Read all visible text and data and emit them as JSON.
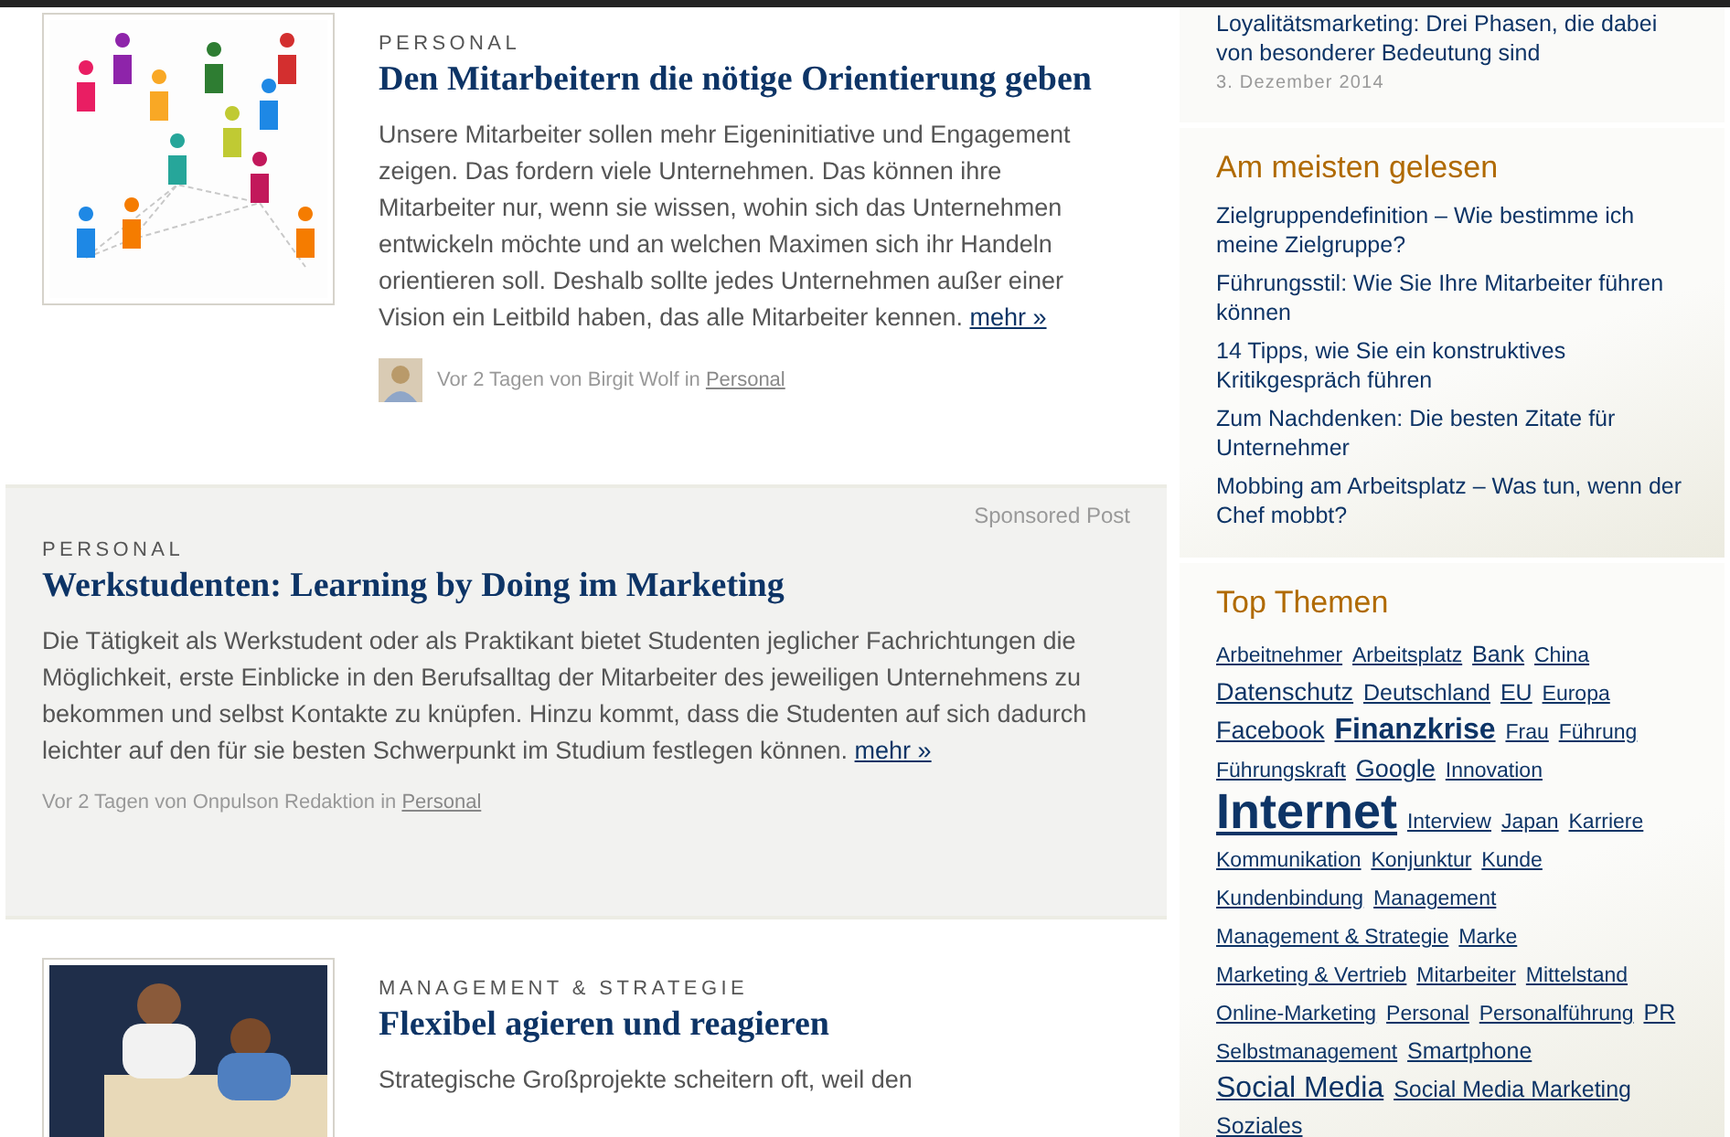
{
  "articles": [
    {
      "kind": "standard",
      "category": "PERSONAL",
      "title": "Den Mitarbeitern die nötige Orientierung geben",
      "body": "Unsere Mitarbeiter sollen mehr Eigeninitiative und Engagement zeigen. Das fordern viele Unternehmen. Das können ihre Mitarbeiter nur, wenn sie wissen, wohin sich das Unternehmen entwickeln möchte und an welchen Maximen sich ihr Handeln orientieren soll. Deshalb sollte jedes Unternehmen außer einer Vision ein Leitbild haben, das alle Mitarbeiter kennen.",
      "more": "mehr »",
      "meta": "Vor 2 Tagen von Birgit Wolf in ",
      "meta_link": "Personal",
      "avatar": true
    },
    {
      "kind": "sponsored",
      "label": "Sponsored Post",
      "category": "PERSONAL",
      "title": "Werkstudenten: Learning by Doing im Marketing",
      "body": "Die Tätigkeit als Werkstudent oder als Praktikant bietet Studenten jeglicher Fachrichtungen die Möglichkeit, erste Einblicke in den Berufsalltag der Mitarbeiter des jeweiligen Unternehmens zu bekommen und selbst Kontakte zu knüpfen. Hinzu kommt, dass die Studenten auf sich dadurch leichter auf den für sie besten Schwerpunkt im Studium festlegen können.",
      "more": "mehr »",
      "meta": "Vor 2 Tagen von Onpulson Redaktion in ",
      "meta_link": "Personal",
      "avatar": false
    },
    {
      "kind": "standard",
      "category": "MANAGEMENT & STRATEGIE",
      "title": "Flexibel agieren und reagieren",
      "body": "Strategische Großprojekte scheitern oft, weil den"
    }
  ],
  "latest": {
    "link": "Loyalitätsmarketing: Drei Phasen, die dabei von besonderer Bedeutung sind",
    "date": "3. Dezember 2014"
  },
  "most_read": {
    "title": "Am meisten gelesen",
    "items": [
      "Zielgruppendefinition – Wie bestimme ich meine Zielgruppe?",
      "Führungsstil: Wie Sie Ihre Mitarbeiter führen können",
      "14 Tipps, wie Sie ein konstruktives Kritikgespräch führen",
      "Zum Nachdenken: Die besten Zitate für Unternehmer",
      "Mobbing am Arbeitsplatz – Was tun, wenn der Chef mobbt?"
    ]
  },
  "top_topics": {
    "title": "Top Themen",
    "tags": [
      {
        "label": "Arbeitnehmer",
        "kind": "small"
      },
      {
        "label": "Arbeitsplatz",
        "kind": "small"
      },
      {
        "label": "Bank",
        "kind": "medium"
      },
      {
        "label": "China",
        "kind": "small"
      },
      {
        "label": "Datenschutz",
        "kind": "large"
      },
      {
        "label": "Deutschland",
        "kind": "medium"
      },
      {
        "label": "EU",
        "kind": "medium"
      },
      {
        "label": "Europa",
        "kind": "small"
      },
      {
        "label": "Facebook",
        "kind": "large"
      },
      {
        "label": "Finanzkrise",
        "kind": "strong"
      },
      {
        "label": "Frau",
        "kind": "small"
      },
      {
        "label": "Führung",
        "kind": "small"
      },
      {
        "label": "Führungskraft",
        "kind": "small"
      },
      {
        "label": "Google",
        "kind": "large"
      },
      {
        "label": "Innovation",
        "kind": "small"
      },
      {
        "label": "Internet",
        "kind": "huge"
      },
      {
        "label": "Interview",
        "kind": "small"
      },
      {
        "label": "Japan",
        "kind": "small"
      },
      {
        "label": "Karriere",
        "kind": "small"
      },
      {
        "label": "Kommunikation",
        "kind": "small"
      },
      {
        "label": "Konjunktur",
        "kind": "small"
      },
      {
        "label": "Kunde",
        "kind": "small"
      },
      {
        "label": "Kundenbindung",
        "kind": "small"
      },
      {
        "label": "Management",
        "kind": "small"
      },
      {
        "label": "Management & Strategie",
        "kind": "small"
      },
      {
        "label": "Marke",
        "kind": "small"
      },
      {
        "label": "Marketing & Vertrieb",
        "kind": "small"
      },
      {
        "label": "Mitarbeiter",
        "kind": "small"
      },
      {
        "label": "Mittelstand",
        "kind": "small"
      },
      {
        "label": "Online-Marketing",
        "kind": "small"
      },
      {
        "label": "Personal",
        "kind": "small"
      },
      {
        "label": "Personalführung",
        "kind": "small"
      },
      {
        "label": "PR",
        "kind": "medium"
      },
      {
        "label": "Selbstmanagement",
        "kind": "small"
      },
      {
        "label": "Smartphone",
        "kind": "medium"
      },
      {
        "label": "Social Media",
        "kind": "xlarge"
      },
      {
        "label": "Social Media Marketing",
        "kind": "medium"
      },
      {
        "label": "Soziales",
        "kind": "medium"
      }
    ]
  }
}
